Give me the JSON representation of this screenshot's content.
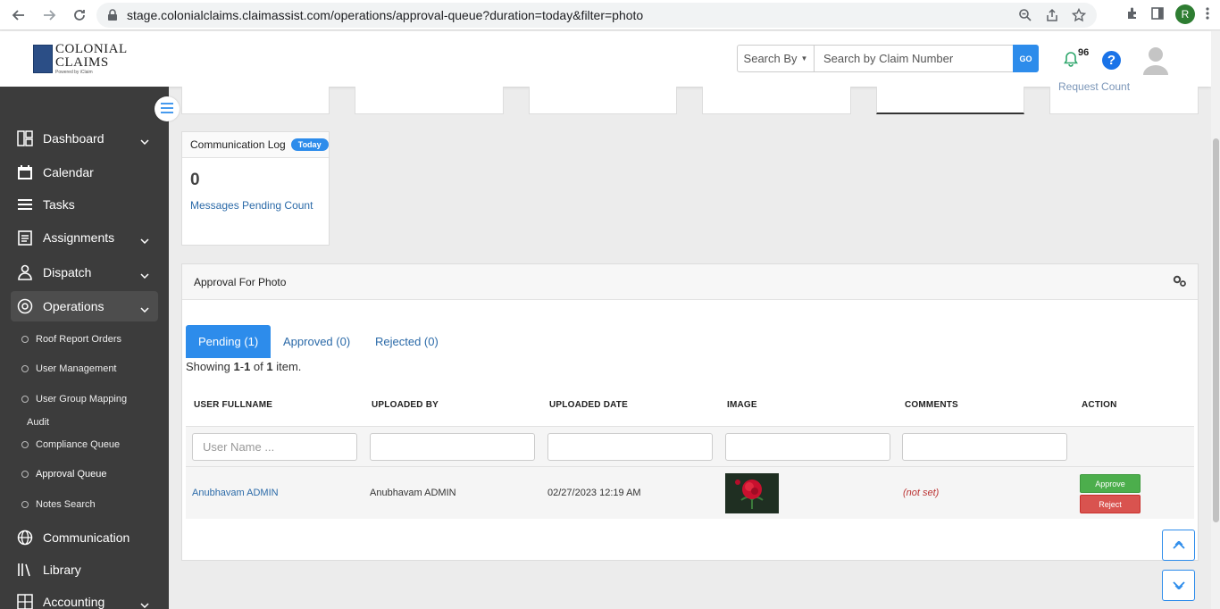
{
  "browser": {
    "url": "stage.colonialclaims.claimassist.com/operations/approval-queue?duration=today&filter=photo",
    "profile_initial": "R"
  },
  "header": {
    "logo_line1": "COLONIAL",
    "logo_line2": "CLAIMS",
    "logo_sub": "Powered by iClaim",
    "search_by_label": "Search By",
    "search_placeholder": "Search by Claim Number",
    "go_label": "GO",
    "notification_count": "96",
    "help_label": "?"
  },
  "sidebar": {
    "items": [
      {
        "label": "Dashboard"
      },
      {
        "label": "Calendar"
      },
      {
        "label": "Tasks"
      },
      {
        "label": "Assignments"
      },
      {
        "label": "Dispatch"
      },
      {
        "label": "Operations"
      },
      {
        "label": "Communication"
      },
      {
        "label": "Library"
      },
      {
        "label": "Accounting"
      }
    ],
    "sub_items": [
      {
        "label": "Roof Report Orders"
      },
      {
        "label": "User Management"
      },
      {
        "label": "User Group Mapping"
      },
      {
        "label": "Audit"
      },
      {
        "label": "Compliance Queue"
      },
      {
        "label": "Approval Queue"
      },
      {
        "label": "Notes Search"
      }
    ]
  },
  "top_cards": {
    "cutoff_label": "Request Count"
  },
  "comm_card": {
    "title": "Communication Log",
    "badge": "Today",
    "count": "0",
    "label": "Messages Pending Count"
  },
  "panel": {
    "title": "Approval For Photo",
    "tabs": [
      {
        "label": "Pending (1)"
      },
      {
        "label": "Approved (0)"
      },
      {
        "label": "Rejected (0)"
      }
    ],
    "summary": {
      "prefix": "Showing ",
      "range_start": "1",
      "range_sep": "-",
      "range_end": "1",
      "of": " of ",
      "total": "1",
      "suffix": " item."
    },
    "columns": [
      "USER FULLNAME",
      "UPLOADED BY",
      "UPLOADED DATE",
      "IMAGE",
      "COMMENTS",
      "ACTION"
    ],
    "filter_placeholder": "User Name ...",
    "rows": [
      {
        "user_fullname": "Anubhavam ADMIN",
        "uploaded_by": "Anubhavam ADMIN",
        "uploaded_date": "02/27/2023 12:19 AM",
        "comments": "(not set)",
        "approve_label": "Approve",
        "reject_label": "Reject"
      }
    ]
  },
  "colors": {
    "sidebar_bg": "#3c3c3c",
    "accent": "#2d8ceb",
    "approve": "#4cae4c",
    "reject": "#d9534f",
    "link": "#2b6aa8"
  }
}
